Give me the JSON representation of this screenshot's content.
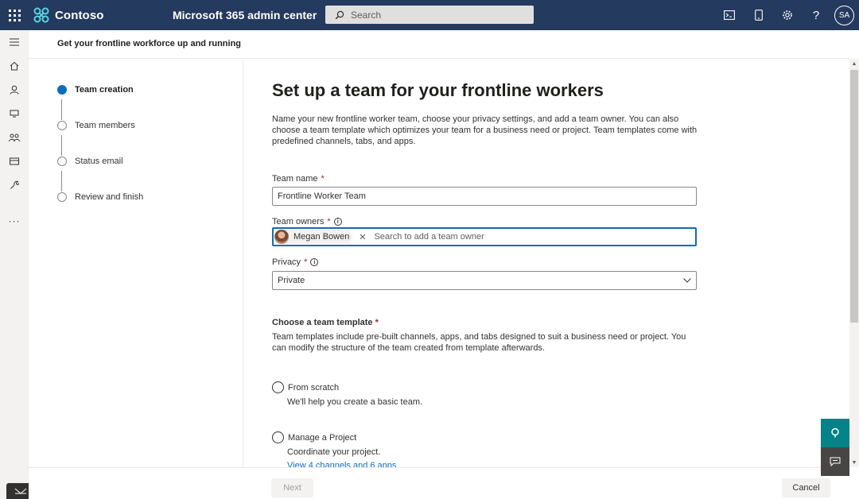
{
  "topbar": {
    "brand_name": "Contoso",
    "app_title": "Microsoft 365 admin center",
    "search_placeholder": "Search",
    "user_initials": "SA",
    "icons": [
      "app-launcher-icon",
      "contoso-logo-icon",
      "search-icon",
      "terminal-icon",
      "mobile-icon",
      "gear-icon",
      "help-icon"
    ]
  },
  "rail": {
    "items": [
      "hamburger-icon",
      "home-icon",
      "user-icon",
      "devices-icon",
      "teams-icon",
      "billing-icon",
      "setup-icon",
      "more-icon"
    ]
  },
  "panel": {
    "title": "Get your frontline workforce up and running"
  },
  "steps": [
    {
      "label": "Team creation",
      "active": true
    },
    {
      "label": "Team members",
      "active": false
    },
    {
      "label": "Status email",
      "active": false
    },
    {
      "label": "Review and finish",
      "active": false
    }
  ],
  "main": {
    "heading": "Set up a team for your frontline workers",
    "description": "Name your new frontline worker team, choose your privacy settings, and add a team owner. You can also choose a team template which optimizes your team for a business need or project. Team templates come with predefined channels, tabs, and apps.",
    "team_name": {
      "label": "Team name",
      "required": "*",
      "value": "Frontline Worker Team"
    },
    "team_owners": {
      "label": "Team owners",
      "required": "*",
      "owner_name": "Megan Bowen",
      "remove": "✕",
      "placeholder": "Search to add a team owner"
    },
    "privacy": {
      "label": "Privacy",
      "required": "*",
      "value": "Private"
    },
    "template": {
      "label": "Choose a team template",
      "required": "*",
      "description": "Team templates include pre-built channels, apps, and tabs designed to suit a business need or project. You can modify the structure of the team created from template afterwards.",
      "options": [
        {
          "label": "From scratch",
          "sub": "We'll help you create a basic team."
        },
        {
          "label": "Manage a Project",
          "sub": "Coordinate your project.",
          "link": "View 4 channels and 6 apps"
        }
      ]
    }
  },
  "footer": {
    "next_label": "Next",
    "cancel_label": "Cancel"
  },
  "colors": {
    "topbar": "#243a5e",
    "accent": "#0f6cbd",
    "help_button": "#038387",
    "chat_button": "#484644"
  }
}
